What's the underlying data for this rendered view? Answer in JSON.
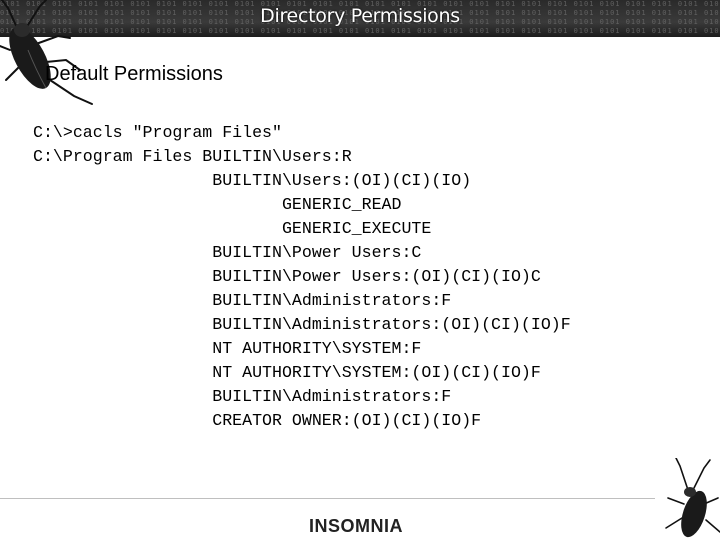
{
  "header": {
    "title": "Directory Permissions"
  },
  "slide": {
    "subtitle": "Default Permissions",
    "command_output": [
      "C:\\>cacls \"Program Files\"",
      "C:\\Program Files BUILTIN\\Users:R",
      "                  BUILTIN\\Users:(OI)(CI)(IO)",
      "                         GENERIC_READ",
      "                         GENERIC_EXECUTE",
      "                  BUILTIN\\Power Users:C",
      "                  BUILTIN\\Power Users:(OI)(CI)(IO)C",
      "                  BUILTIN\\Administrators:F",
      "                  BUILTIN\\Administrators:(OI)(CI)(IO)F",
      "                  NT AUTHORITY\\SYSTEM:F",
      "                  NT AUTHORITY\\SYSTEM:(OI)(CI)(IO)F",
      "                  BUILTIN\\Administrators:F",
      "                  CREATOR OWNER:(OI)(CI)(IO)F"
    ]
  },
  "footer": {
    "logo": "INSOMNIA"
  },
  "decor": {
    "icons": [
      "cockroach-icon"
    ],
    "colors": {
      "header_band": "#2e2e2e",
      "header_text": "#ffffff"
    }
  }
}
